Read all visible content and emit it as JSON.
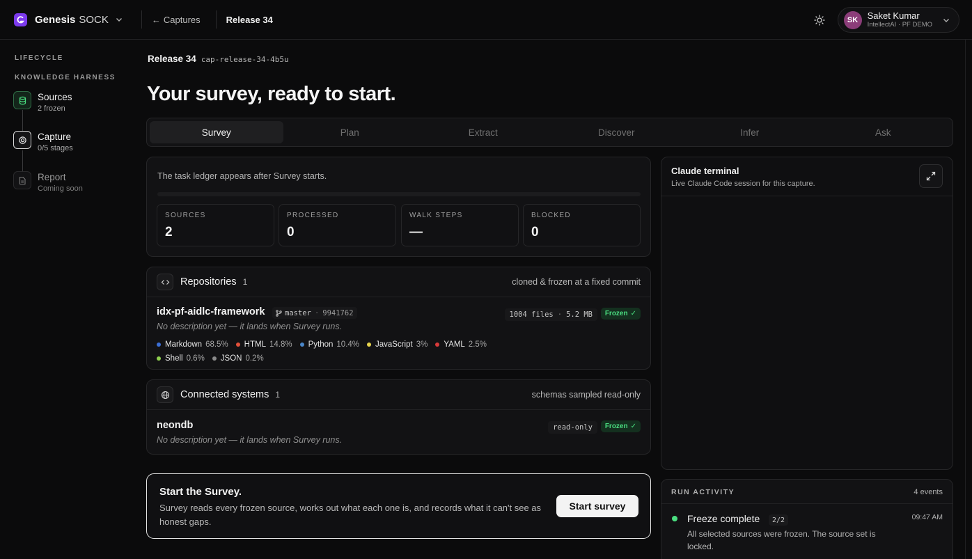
{
  "header": {
    "brand_name": "Genesis",
    "brand_product": "SOCK",
    "back_label": "Captures",
    "current_crumb": "Release 34",
    "user": {
      "initials": "SK",
      "name": "Saket Kumar",
      "org": "IntellectAI · PF DEMO"
    }
  },
  "sidebar": {
    "section_label": "LIFECYCLE",
    "group_label": "KNOWLEDGE HARNESS",
    "steps": [
      {
        "title": "Sources",
        "sub": "2 frozen",
        "state": "done",
        "icon": "database-icon"
      },
      {
        "title": "Capture",
        "sub": "0/5 stages",
        "state": "active",
        "icon": "target-icon"
      },
      {
        "title": "Report",
        "sub": "Coming soon",
        "state": "disabled",
        "icon": "document-icon"
      }
    ]
  },
  "release": {
    "name": "Release 34",
    "id": "cap-release-34-4b5u"
  },
  "page_title": "Your survey, ready to start.",
  "tabs": [
    {
      "label": "Survey",
      "active": true
    },
    {
      "label": "Plan",
      "active": false
    },
    {
      "label": "Extract",
      "active": false
    },
    {
      "label": "Discover",
      "active": false
    },
    {
      "label": "Infer",
      "active": false
    },
    {
      "label": "Ask",
      "active": false
    }
  ],
  "ledger": {
    "note": "The task ledger appears after Survey starts.",
    "stats": [
      {
        "label": "SOURCES",
        "value": "2"
      },
      {
        "label": "PROCESSED",
        "value": "0"
      },
      {
        "label": "WALK STEPS",
        "value": "—"
      },
      {
        "label": "BLOCKED",
        "value": "0"
      }
    ]
  },
  "repositories": {
    "title": "Repositories",
    "count": "1",
    "meta": "cloned & frozen at a fixed commit",
    "items": [
      {
        "name": "idx-pf-aidlc-framework",
        "branch": "master",
        "commit": "9941762",
        "description": "No description yet — it lands when Survey runs.",
        "files": "1004 files",
        "size": "5.2 MB",
        "status": "Frozen",
        "languages": [
          {
            "name": "Markdown",
            "pct": "68.5%",
            "color": "#3b6fd6"
          },
          {
            "name": "HTML",
            "pct": "14.8%",
            "color": "#e3503a"
          },
          {
            "name": "Python",
            "pct": "10.4%",
            "color": "#4a86c8"
          },
          {
            "name": "JavaScript",
            "pct": "3%",
            "color": "#e8d44d"
          },
          {
            "name": "YAML",
            "pct": "2.5%",
            "color": "#d83a3a"
          },
          {
            "name": "Shell",
            "pct": "0.6%",
            "color": "#8fd14f"
          },
          {
            "name": "JSON",
            "pct": "0.2%",
            "color": "#8a8a8a"
          }
        ]
      }
    ]
  },
  "connected_systems": {
    "title": "Connected systems",
    "count": "1",
    "meta": "schemas sampled read-only",
    "items": [
      {
        "name": "neondb",
        "access": "read-only",
        "status": "Frozen",
        "description": "No description yet — it lands when Survey runs."
      }
    ]
  },
  "start": {
    "title": "Start the Survey.",
    "description": "Survey reads every frozen source, works out what each one is, and records what it can't see as honest gaps.",
    "button": "Start survey"
  },
  "terminal": {
    "title": "Claude terminal",
    "subtitle": "Live Claude Code session for this capture."
  },
  "activity": {
    "label": "RUN ACTIVITY",
    "count": "4 events",
    "events": [
      {
        "title": "Freeze complete",
        "chip": "2/2",
        "time": "09:47 AM",
        "description": "All selected sources were frozen. The source set is locked.",
        "color": "#4ade80"
      }
    ]
  },
  "colors": {
    "accent": "#7c3aed",
    "frozen_green": "#4ade80",
    "background": "#0b0b0c"
  }
}
